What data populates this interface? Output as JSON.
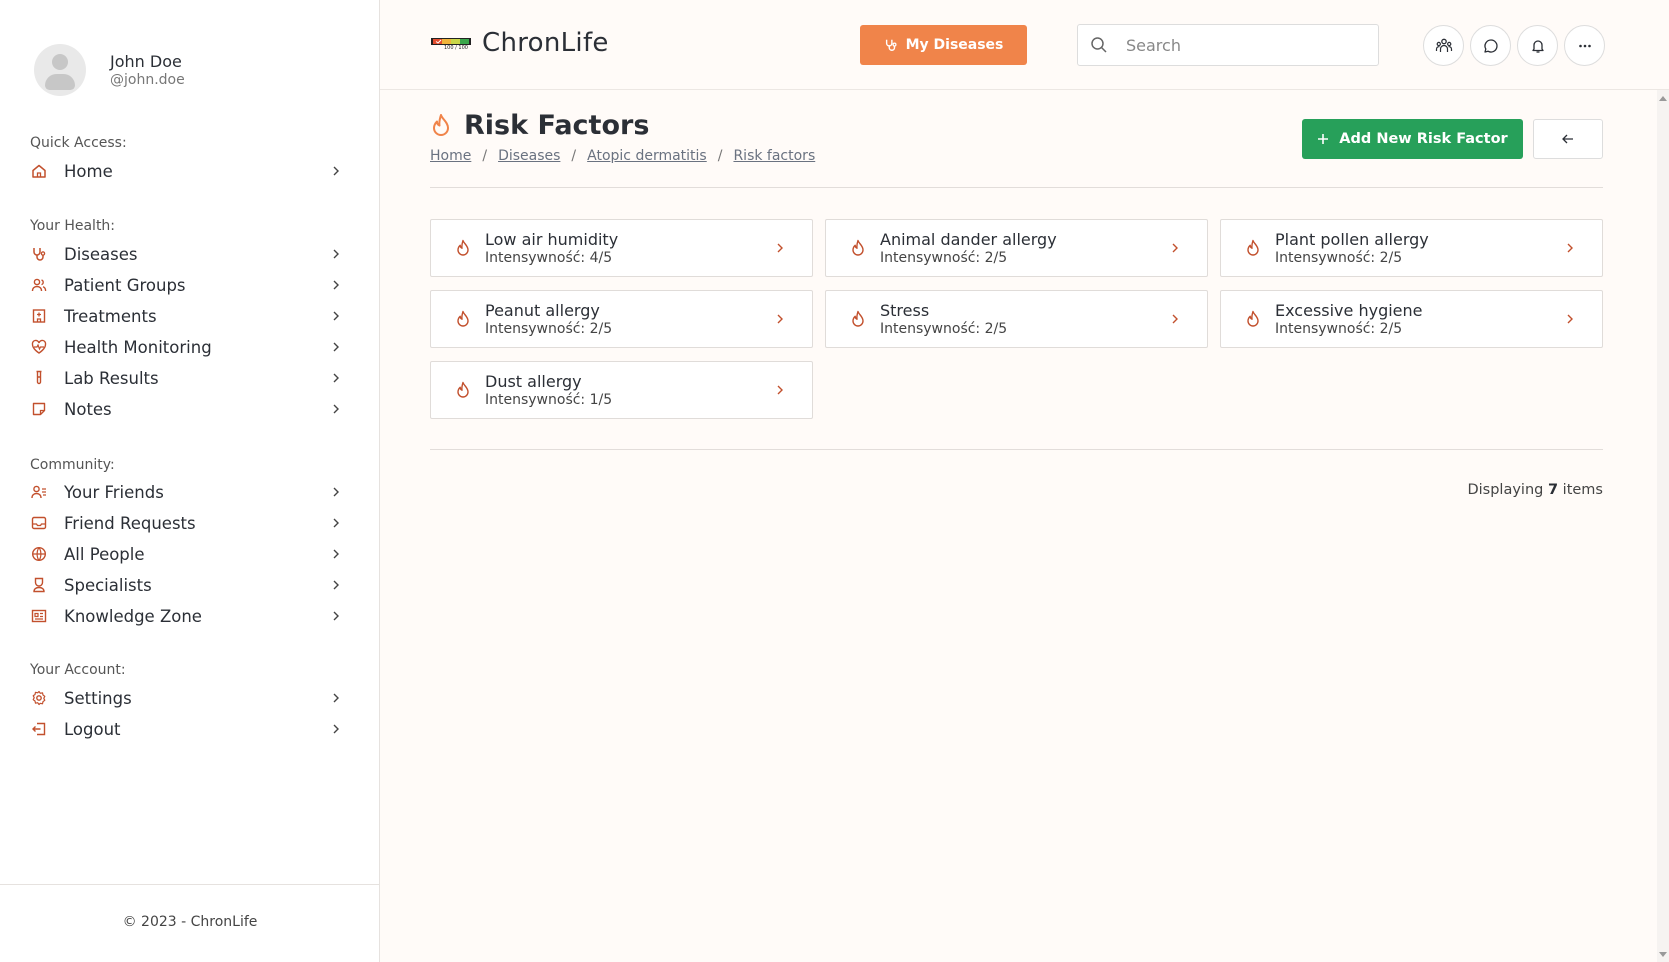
{
  "user": {
    "name": "John Doe",
    "handle": "@john.doe"
  },
  "sidebar": {
    "sections": [
      {
        "title": "Quick Access:",
        "items": [
          {
            "label": "Home",
            "icon": "home-icon"
          }
        ]
      },
      {
        "title": "Your Health:",
        "items": [
          {
            "label": "Diseases",
            "icon": "stethoscope-icon"
          },
          {
            "label": "Patient Groups",
            "icon": "users-icon"
          },
          {
            "label": "Treatments",
            "icon": "hospital-icon"
          },
          {
            "label": "Health Monitoring",
            "icon": "heart-pulse-icon"
          },
          {
            "label": "Lab Results",
            "icon": "test-tube-icon"
          },
          {
            "label": "Notes",
            "icon": "note-icon"
          }
        ]
      },
      {
        "title": "Community:",
        "items": [
          {
            "label": "Your Friends",
            "icon": "user-list-icon"
          },
          {
            "label": "Friend Requests",
            "icon": "inbox-icon"
          },
          {
            "label": "All People",
            "icon": "globe-icon"
          },
          {
            "label": "Specialists",
            "icon": "doctor-icon"
          },
          {
            "label": "Knowledge Zone",
            "icon": "newspaper-icon"
          }
        ]
      },
      {
        "title": "Your Account:",
        "items": [
          {
            "label": "Settings",
            "icon": "gear-icon"
          },
          {
            "label": "Logout",
            "icon": "logout-icon"
          }
        ]
      }
    ],
    "footer": "© 2023 - ChronLife"
  },
  "header": {
    "app_name": "ChronLife",
    "logo_caption": "100 / 100",
    "my_diseases_label": "My Diseases",
    "search_placeholder": "Search"
  },
  "page": {
    "title": "Risk Factors",
    "breadcrumb": [
      "Home",
      "Diseases",
      "Atopic dermatitis",
      "Risk factors"
    ],
    "add_button_label": "Add New Risk Factor",
    "items": [
      {
        "name": "Low air humidity",
        "intensity": "Intensywność: 4/5"
      },
      {
        "name": "Animal dander allergy",
        "intensity": "Intensywność: 2/5"
      },
      {
        "name": "Plant pollen allergy",
        "intensity": "Intensywność: 2/5"
      },
      {
        "name": "Peanut allergy",
        "intensity": "Intensywność: 2/5"
      },
      {
        "name": "Stress",
        "intensity": "Intensywność: 2/5"
      },
      {
        "name": "Excessive hygiene",
        "intensity": "Intensywność: 2/5"
      },
      {
        "name": "Dust allergy",
        "intensity": "Intensywność: 1/5"
      }
    ],
    "count_prefix": "Displaying",
    "count_value": "7",
    "count_suffix": "items"
  },
  "colors": {
    "accent": "#f0844a",
    "success": "#27a05a",
    "icon": "#c2502d",
    "background": "#fffbf8"
  }
}
